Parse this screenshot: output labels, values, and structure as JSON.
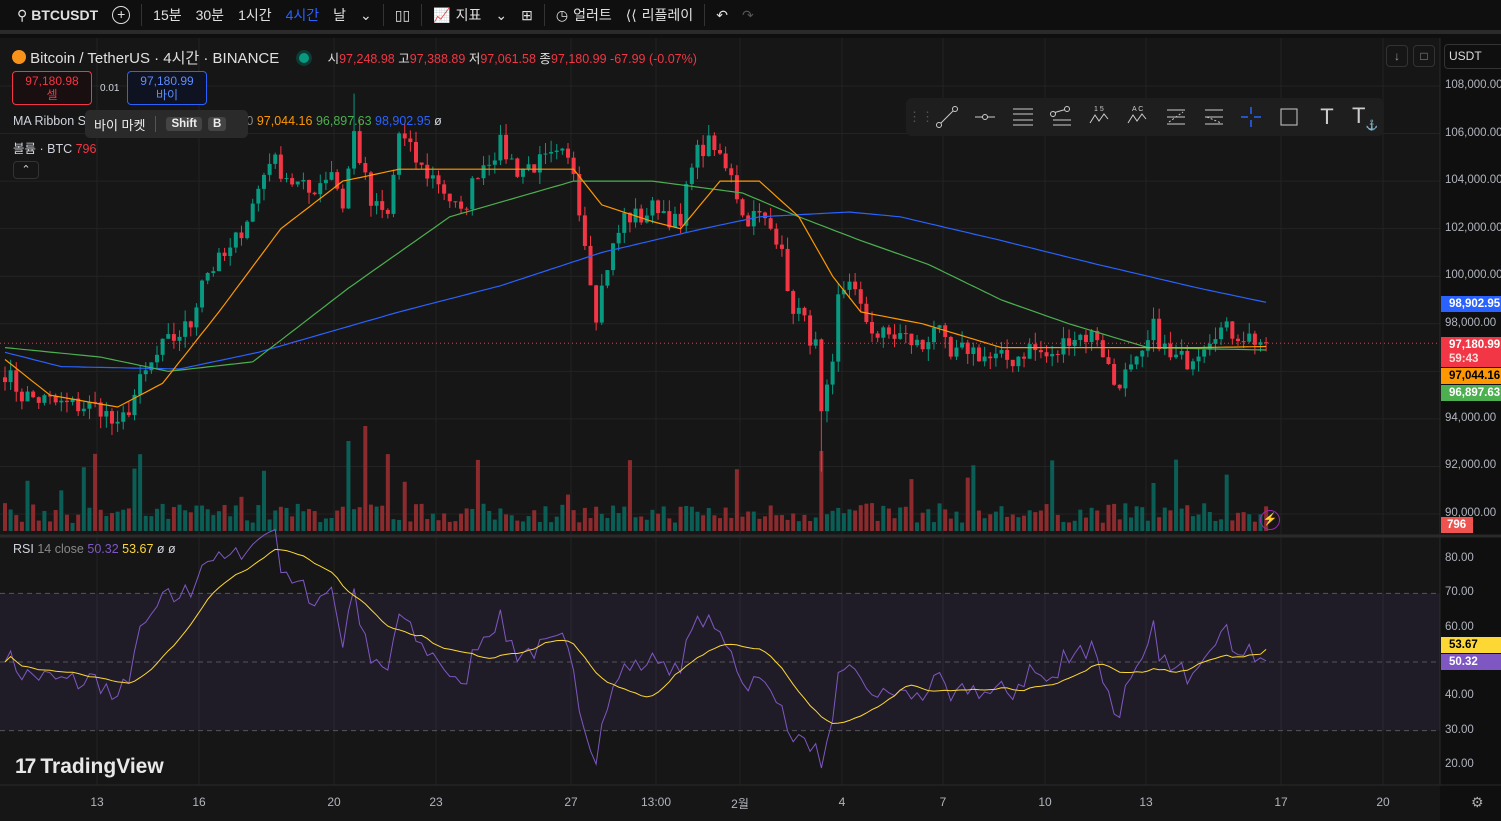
{
  "toolbar": {
    "symbol": "BTCUSDT",
    "intervals": [
      "15분",
      "30분",
      "1시간",
      "4시간",
      "날"
    ],
    "active_interval": "4시간",
    "indicators": "지표",
    "alert": "얼러트",
    "replay": "리플레이"
  },
  "legend": {
    "title": "Bitcoin / TetherUS · 4시간 · BINANCE",
    "open_label": "시",
    "open": "97,248.98",
    "high_label": "고",
    "high": "97,388.89",
    "low_label": "저",
    "low": "97,061.58",
    "close_label": "종",
    "close": "97,180.99",
    "change": "-67.99 (-0.07%)",
    "sell_price": "97,180.98",
    "sell_label": "셀",
    "spread": "0.01",
    "buy_price": "97,180.99",
    "buy_label": "바이",
    "ma_label": "MA Ribbon S",
    "ma_hidden_tail": "00",
    "ma1": "97,044.16",
    "ma2": "96,897.63",
    "ma3": "98,902.95",
    "ma_tail": "ø",
    "volume_label": "볼륨 · BTC",
    "volume": "796",
    "tooltip": {
      "text": "바이 마켓",
      "key1": "Shift",
      "key2": "B"
    }
  },
  "rsi": {
    "label": "RSI",
    "params": "14 close",
    "value": "50.32",
    "ma": "53.67",
    "tail1": "ø",
    "tail2": "ø"
  },
  "price_axis": {
    "currency": "USDT",
    "ticks": [
      "108,000.00",
      "106,000.00",
      "104,000.00",
      "102,000.00",
      "100,000.00",
      "98,000.00",
      "94,000.00",
      "92,000.00",
      "90,000.00"
    ],
    "tags": {
      "ma3": "98,902.95",
      "last": "97,180.99",
      "countdown": "59:43",
      "ma1": "97,044.16",
      "ma2": "96,897.63",
      "volume": "796"
    }
  },
  "rsi_axis": {
    "ticks": [
      "80.00",
      "70.00",
      "60.00",
      "40.00",
      "30.00",
      "20.00"
    ],
    "tags": {
      "ma": "53.67",
      "rsi": "50.32"
    }
  },
  "time_axis": [
    "13",
    "16",
    "20",
    "23",
    "27",
    "13:00",
    "2월",
    "4",
    "7",
    "10",
    "13",
    "17",
    "20"
  ],
  "brand": "TradingView",
  "colors": {
    "up": "#089981",
    "down": "#f23645",
    "ma_fast": "#ff9800",
    "ma_mid": "#4caf50",
    "ma_slow": "#2962ff",
    "rsi": "#7e57c2",
    "rsi_ma": "#fdd835",
    "accent": "#2962ff"
  },
  "chart_data": {
    "type": "candlestick",
    "candles": 225,
    "price_range": [
      89400,
      109000
    ],
    "close_keyframes": [
      [
        0,
        96000
      ],
      [
        3,
        95000
      ],
      [
        10,
        94600
      ],
      [
        17,
        94500
      ],
      [
        20,
        93500
      ],
      [
        24,
        95500
      ],
      [
        28,
        97000
      ],
      [
        33,
        98000
      ],
      [
        35,
        100000
      ],
      [
        40,
        101000
      ],
      [
        44,
        103000
      ],
      [
        47,
        105000
      ],
      [
        51,
        104000
      ],
      [
        54,
        103500
      ],
      [
        58,
        104500
      ],
      [
        60,
        103000
      ],
      [
        62,
        106000
      ],
      [
        65,
        103000
      ],
      [
        68,
        102500
      ],
      [
        70,
        106000
      ],
      [
        74,
        104500
      ],
      [
        77,
        104000
      ],
      [
        81,
        102500
      ],
      [
        84,
        104500
      ],
      [
        88,
        105500
      ],
      [
        91,
        104500
      ],
      [
        99,
        105000
      ],
      [
        101,
        104500
      ],
      [
        103,
        101500
      ],
      [
        105,
        98500
      ],
      [
        107,
        100500
      ],
      [
        110,
        102500
      ],
      [
        113,
        102500
      ],
      [
        116,
        103000
      ],
      [
        120,
        102000
      ],
      [
        122,
        105000
      ],
      [
        125,
        105500
      ],
      [
        129,
        104500
      ],
      [
        131,
        102500
      ],
      [
        134,
        102500
      ],
      [
        138,
        101500
      ],
      [
        139,
        99000
      ],
      [
        141,
        98500
      ],
      [
        144,
        97000
      ],
      [
        145,
        94000
      ],
      [
        147,
        96000
      ],
      [
        148,
        99000
      ],
      [
        150,
        100000
      ],
      [
        152,
        98500
      ],
      [
        155,
        97500
      ],
      [
        159,
        97500
      ],
      [
        163,
        97000
      ],
      [
        165,
        98000
      ],
      [
        168,
        96500
      ],
      [
        171,
        97000
      ],
      [
        175,
        96500
      ],
      [
        179,
        96500
      ],
      [
        182,
        97000
      ],
      [
        186,
        96500
      ],
      [
        189,
        97500
      ],
      [
        193,
        97500
      ],
      [
        194,
        97500
      ],
      [
        197,
        95500
      ],
      [
        200,
        96000
      ],
      [
        202,
        96500
      ],
      [
        204,
        97800
      ],
      [
        207,
        96500
      ],
      [
        210,
        96500
      ],
      [
        212,
        97000
      ],
      [
        215,
        97800
      ],
      [
        219,
        97600
      ],
      [
        224,
        97180
      ]
    ],
    "ma_fast_keyframes": [
      [
        0,
        96500
      ],
      [
        8,
        95000
      ],
      [
        20,
        94500
      ],
      [
        28,
        95500
      ],
      [
        38,
        98500
      ],
      [
        49,
        102000
      ],
      [
        60,
        104000
      ],
      [
        70,
        104500
      ],
      [
        88,
        104500
      ],
      [
        101,
        104500
      ],
      [
        106,
        103000
      ],
      [
        115,
        102300
      ],
      [
        120,
        102000
      ],
      [
        127,
        104000
      ],
      [
        134,
        104000
      ],
      [
        141,
        102500
      ],
      [
        147,
        100000
      ],
      [
        152,
        98500
      ],
      [
        163,
        98000
      ],
      [
        177,
        97000
      ],
      [
        194,
        97000
      ],
      [
        212,
        97000
      ],
      [
        224,
        97044
      ]
    ],
    "ma_mid_keyframes": [
      [
        0,
        97000
      ],
      [
        17,
        96600
      ],
      [
        29,
        96000
      ],
      [
        44,
        96400
      ],
      [
        61,
        99500
      ],
      [
        79,
        102500
      ],
      [
        101,
        104000
      ],
      [
        115,
        104000
      ],
      [
        131,
        103500
      ],
      [
        141,
        102500
      ],
      [
        152,
        101500
      ],
      [
        164,
        100500
      ],
      [
        177,
        99000
      ],
      [
        189,
        98000
      ],
      [
        203,
        97000
      ],
      [
        224,
        96898
      ]
    ],
    "ma_slow_keyframes": [
      [
        0,
        96800
      ],
      [
        10,
        96200
      ],
      [
        31,
        96100
      ],
      [
        45,
        96800
      ],
      [
        70,
        98500
      ],
      [
        88,
        99600
      ],
      [
        106,
        101000
      ],
      [
        124,
        102000
      ],
      [
        134,
        102500
      ],
      [
        150,
        102700
      ],
      [
        159,
        102500
      ],
      [
        177,
        101500
      ],
      [
        194,
        100500
      ],
      [
        212,
        99500
      ],
      [
        224,
        98903
      ]
    ],
    "rsi_range": [
      15,
      85
    ],
    "rsi_levels": [
      70,
      50,
      30
    ]
  }
}
